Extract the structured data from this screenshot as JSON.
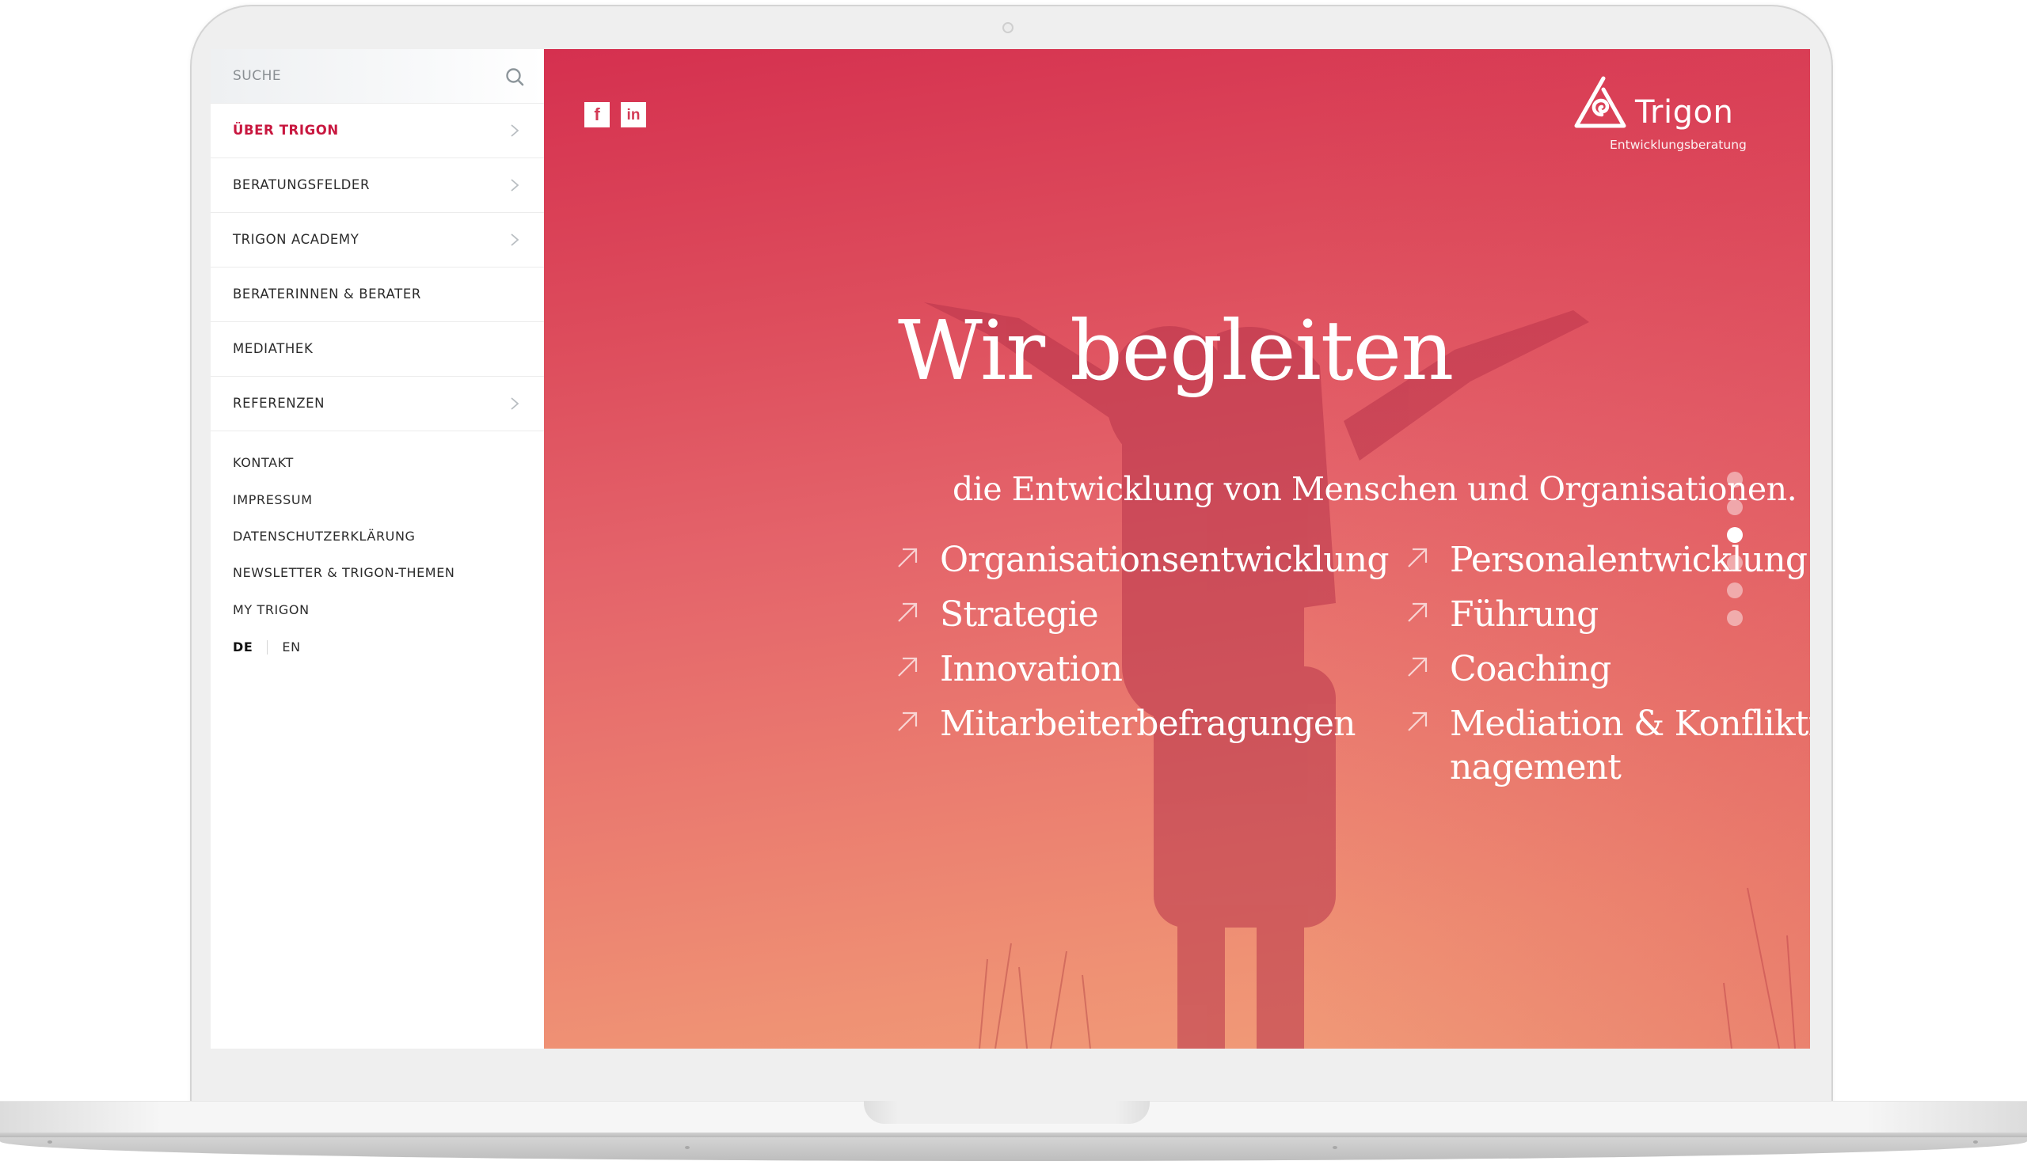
{
  "sidebar": {
    "search": {
      "placeholder": "SUCHE",
      "icon": "search-icon"
    },
    "nav_items": [
      {
        "label": "ÜBER TRIGON",
        "active": true,
        "has_submenu": true
      },
      {
        "label": "BERATUNGSFELDER",
        "active": false,
        "has_submenu": true
      },
      {
        "label": "TRIGON ACADEMY",
        "active": false,
        "has_submenu": true
      },
      {
        "label": "BERATERINNEN & BERATER",
        "active": false,
        "has_submenu": false
      },
      {
        "label": "MEDIATHEK",
        "active": false,
        "has_submenu": false
      },
      {
        "label": "REFERENZEN",
        "active": false,
        "has_submenu": true
      }
    ],
    "secondary_links": [
      "KONTAKT",
      "IMPRESSUM",
      "DATENSCHUTZERKLÄRUNG",
      "NEWSLETTER & TRIGON-THEMEN",
      "MY TRIGON"
    ],
    "languages": {
      "current": "DE",
      "other": "EN"
    }
  },
  "hero": {
    "social": [
      {
        "name": "facebook",
        "glyph": "f"
      },
      {
        "name": "linkedin",
        "glyph": "in"
      }
    ],
    "logo": {
      "name": "Trigon",
      "tagline": "Entwicklungsberatung"
    },
    "headline": "Wir begleiten",
    "subline": "die Entwicklung von Menschen und Organisationen.",
    "topics_left": [
      "Organisationsentwicklung",
      "Strategie",
      "Innovation",
      "Mitarbeiterbefragungen"
    ],
    "topics_right": [
      "Personalentwicklung",
      "Führung",
      "Coaching",
      "Mediation & Konfliktma-\nnagement"
    ],
    "slider": {
      "total": 6,
      "active_index": 3
    }
  },
  "colors": {
    "accent": "#c8173f",
    "hero_top": "#d5304f",
    "hero_bottom": "#f19e79",
    "text_dark": "#2b2b2b"
  }
}
